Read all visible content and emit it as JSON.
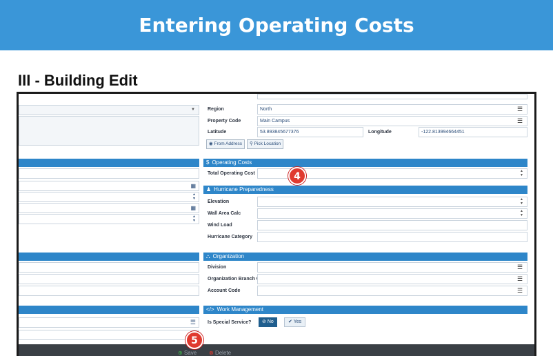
{
  "banner": {
    "title": "Entering Operating Costs"
  },
  "page_heading": "III - Building Edit",
  "location": {
    "region_label": "Region",
    "region_value": "North",
    "property_code_label": "Property Code",
    "property_code_value": "Main Campus",
    "latitude_label": "Latitude",
    "latitude_value": "53.893845677376",
    "longitude_label": "Longitude",
    "longitude_value": "-122.813994664451",
    "from_address_label": "From Address",
    "pick_location_label": "Pick Location"
  },
  "operating_costs": {
    "title": "Operating Costs",
    "total_label": "Total Operating Cost",
    "total_value": ""
  },
  "hurricane": {
    "title": "Hurricane Preparedness",
    "elevation_label": "Elevation",
    "wall_area_label": "Wall Area Calc",
    "wind_load_label": "Wind Load",
    "category_label": "Hurricane Category"
  },
  "organization": {
    "title": "Organization",
    "division_label": "Division",
    "branch_label": "Organization Branch C",
    "account_label": "Account Code"
  },
  "work_management": {
    "title": "Work Management",
    "special_label": "Is Special Service?",
    "no_label": "No",
    "yes_label": "Yes"
  },
  "footer": {
    "save_label": "Save",
    "delete_label": "Delete"
  },
  "callouts": {
    "four": "4",
    "five": "5"
  },
  "colors": {
    "banner": "#3a96d8",
    "section_bar": "#2e86c9",
    "callout": "#e03a2f",
    "footer": "#3a3f45"
  }
}
